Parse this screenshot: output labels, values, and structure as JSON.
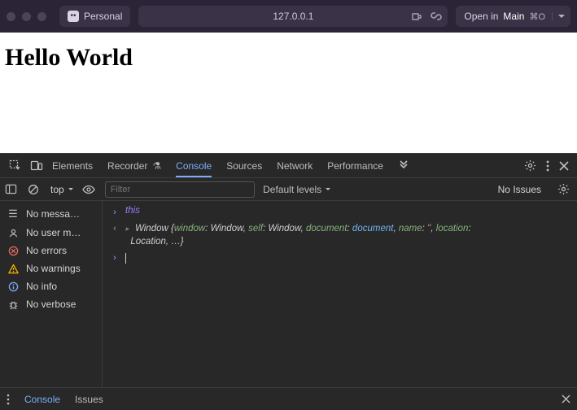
{
  "chrome": {
    "profile_label": "Personal",
    "address": "127.0.0.1",
    "open_in_label": "Open in",
    "open_in_target": "Main",
    "open_in_shortcut": "⌘O"
  },
  "page": {
    "heading": "Hello World"
  },
  "devtools": {
    "tabs": {
      "elements": "Elements",
      "recorder": "Recorder",
      "console": "Console",
      "sources": "Sources",
      "network": "Network",
      "performance": "Performance"
    },
    "toolbar": {
      "context": "top",
      "filter_placeholder": "Filter",
      "levels": "Default levels",
      "issues": "No Issues"
    },
    "sidebar": {
      "messages": "No messa…",
      "user": "No user m…",
      "errors": "No errors",
      "warnings": "No warnings",
      "info": "No info",
      "verbose": "No verbose"
    },
    "console": {
      "input": "this",
      "output": {
        "head": "Window ",
        "k_window": "window",
        "v_window": "Window",
        "k_self": "self",
        "v_self": "Window",
        "k_document": "document",
        "v_document": "document",
        "k_name": "name",
        "v_name": "''",
        "k_location": "location",
        "v_location": "Location",
        "tail": ", …}"
      }
    },
    "drawer": {
      "console": "Console",
      "issues": "Issues"
    }
  }
}
